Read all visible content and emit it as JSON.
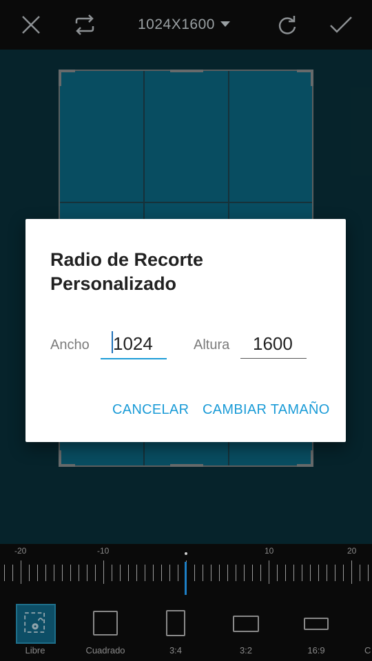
{
  "topbar": {
    "size_label": "1024X1600",
    "icons": [
      "close-icon",
      "swap-icon",
      "chevron-down-icon",
      "redo-icon",
      "check-icon"
    ]
  },
  "colors": {
    "accent": "#1a9bd7",
    "crop_fill": "#0a5b73",
    "background": "#082a33"
  },
  "dialog": {
    "title": "Radio de Recorte Personalizado",
    "width_label": "Ancho",
    "width_value": "1024",
    "height_label": "Altura",
    "height_value": "1600",
    "cancel_label": "CANCELAR",
    "resize_label": "CAMBIAR TAMAÑO"
  },
  "ruler": {
    "labels": [
      "-20",
      "-10",
      "10",
      "20"
    ]
  },
  "aspect": {
    "items": [
      "Libre",
      "Cuadrado",
      "3:4",
      "3:2",
      "16:9",
      "C"
    ]
  }
}
